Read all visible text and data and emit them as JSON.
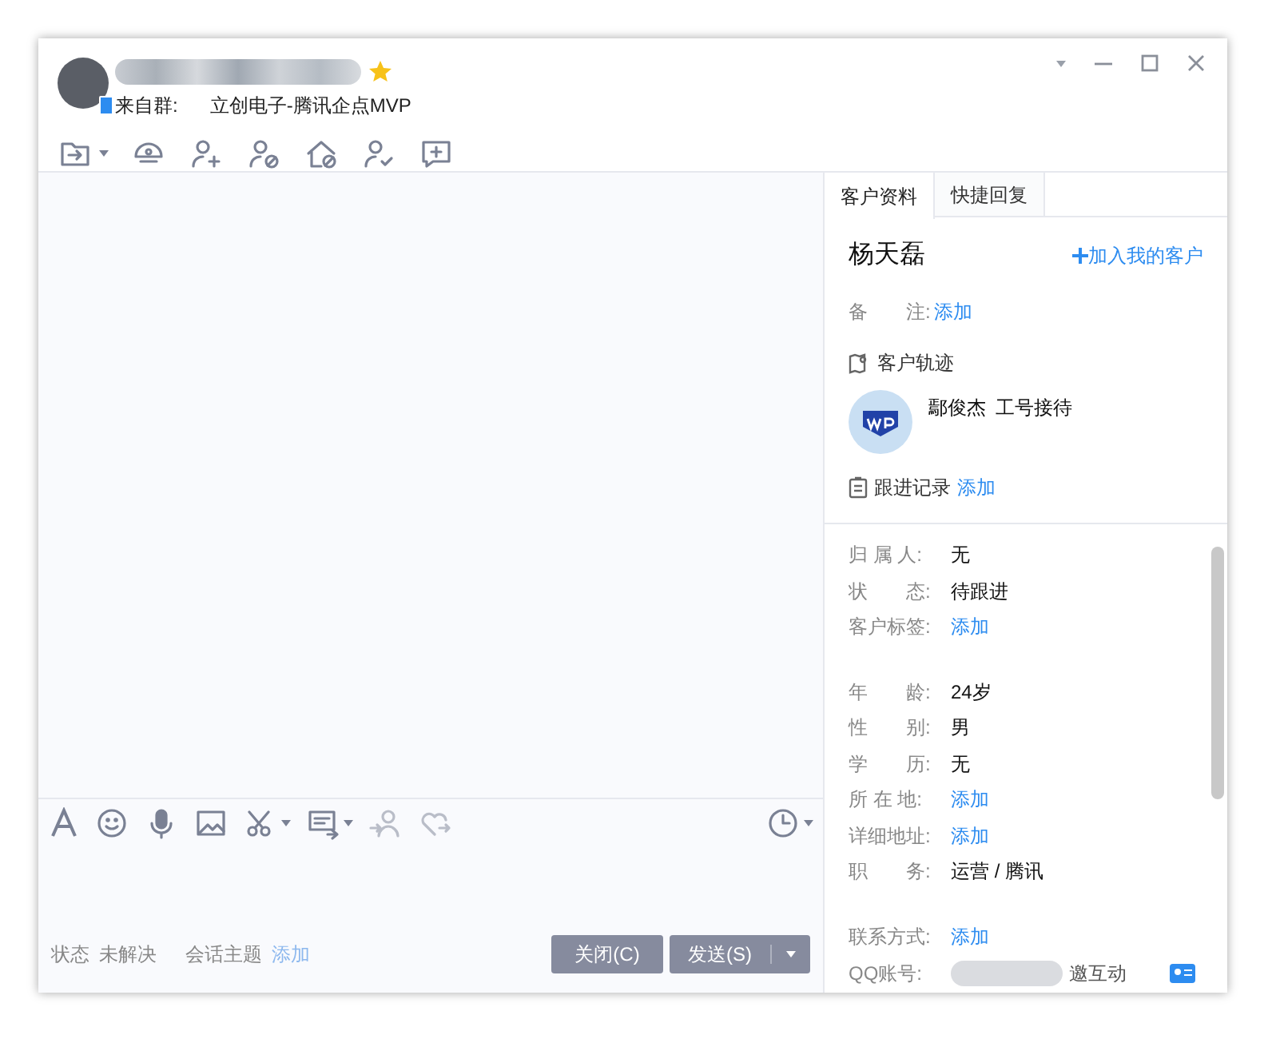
{
  "header": {
    "source_label": "来自群:",
    "source_value": "立创电子-腾讯企点MVP"
  },
  "tabs": [
    {
      "label": "客户资料",
      "selected": true
    },
    {
      "label": "快捷回复",
      "selected": false
    }
  ],
  "customer": {
    "name": "杨天磊",
    "add_link": "加入我的客户",
    "note_label": "备　　注:",
    "note_value": "添加",
    "track_heading": "客户轨迹",
    "track_person": "鄢俊杰",
    "track_note": "工号接待",
    "followup_heading": "跟进记录",
    "followup_link": "添加"
  },
  "field_groups": [
    [
      {
        "label": "归 属 人:",
        "value": "无",
        "kind": "text"
      },
      {
        "label": "状　　态:",
        "value": "待跟进",
        "kind": "text"
      },
      {
        "label": "客户标签:",
        "value": "添加",
        "kind": "link"
      }
    ],
    [
      {
        "label": "年　　龄:",
        "value": "24岁",
        "kind": "text"
      },
      {
        "label": "性　　别:",
        "value": "男",
        "kind": "text"
      },
      {
        "label": "学　　历:",
        "value": "无",
        "kind": "text"
      },
      {
        "label": "所 在 地:",
        "value": "添加",
        "kind": "link"
      },
      {
        "label": "详细地址:",
        "value": "添加",
        "kind": "link"
      },
      {
        "label": "职　　务:",
        "value": "运营 / 腾讯",
        "kind": "text"
      }
    ],
    [
      {
        "label": "联系方式:",
        "value": "添加",
        "kind": "link"
      }
    ]
  ],
  "qq_row": {
    "label": "QQ账号:",
    "suffix": "邀互动"
  },
  "status": {
    "state_label": "状态",
    "state_value": "未解决",
    "topic_label": "会话主题",
    "topic_link": "添加"
  },
  "buttons": {
    "close": "关闭(C)",
    "send": "发送(S)"
  }
}
